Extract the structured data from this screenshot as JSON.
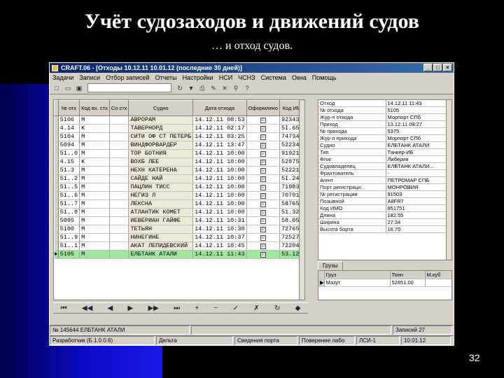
{
  "slide": {
    "title": "Учёт судозаходов и движений судов",
    "subtitle": "… и отход судов.",
    "page_number": "32"
  },
  "window": {
    "title": "CRAFT.06 - [Отходы 10.12.11 10.01.12 (последние 30 дней)]",
    "app_icon": "app-icon",
    "controls": [
      "_",
      "□",
      "×"
    ]
  },
  "menu": [
    "Задачи",
    "Записи",
    "Отбор записей",
    "Отчеты",
    "Настройки",
    "НСИ",
    "ЧСНЗ",
    "Система",
    "Окна",
    "Помощь"
  ],
  "toolbar": {
    "buttons": [
      "new-icon",
      "open-icon",
      "save-icon",
      "refresh-icon",
      "filter-icon",
      "print-icon",
      "edit-icon",
      "delete-icon",
      "find-icon",
      "help-icon"
    ]
  },
  "grid": {
    "headers": [
      "№ отх",
      "Код вх. стх",
      "Со стх",
      "Судно",
      "Дата отхода",
      "Оформлено",
      "Код ИМО",
      "Р"
    ],
    "rows": [
      [
        "5106",
        "М",
        "",
        "АВРОРАМ",
        "14.12.11 08:53",
        "☑",
        "9234389",
        "55"
      ],
      [
        "4.14",
        "К",
        "",
        "ТАВЕРНОРД",
        "14.12.11 02:17",
        "☑",
        "5I.6550",
        "60"
      ],
      [
        "5104",
        "М",
        "",
        "СИТИ ОФ СТ ПЕТЕРБ",
        "14.12.11 03:25",
        "☑",
        "7473456",
        "61"
      ],
      [
        "5094",
        "М",
        "",
        "ВИНДФОРВАРДЕР",
        "14.12.11 13:47",
        "☑",
        "5223452",
        "61"
      ],
      [
        "51..0",
        "М",
        "",
        "ТОР БОТНИЯ",
        "14.12.11 10:00",
        "☑",
        "9192129",
        "60"
      ],
      [
        "4.15",
        "К",
        "",
        "ВОХБ ЛЕЕ",
        "14.12.11 10:00",
        "☑",
        "5287507",
        "60"
      ],
      [
        "51.3",
        "М",
        "",
        "НЕХН КАТЕРЕНА",
        "14.12.11 10:00",
        "☑",
        "5222185",
        "60"
      ],
      [
        "51..2",
        "М",
        "",
        "САЙДЕ НАЙ",
        "14.12.11 10:00",
        "☑",
        "5I.2465",
        "55"
      ],
      [
        "51..5",
        "М",
        "",
        "ПАЦЛИН ТИСС",
        "14.12.11 10:00",
        "☑",
        "7198389",
        "60"
      ],
      [
        "51..6",
        "М",
        "",
        "НЕГИЗ Л",
        "14.12.11 10:00",
        "☑",
        "7070110",
        "55"
      ],
      [
        "51..7",
        "М",
        "",
        "ЛЕКСНА",
        "14.12.11 10:00",
        "☑",
        "5876572",
        "60"
      ],
      [
        "51..8",
        "М",
        "",
        "АТЛАНТИК КОМЕТ",
        "14.12.11 10:00",
        "☑",
        "51.3233",
        "60"
      ],
      [
        "5095",
        "М",
        "",
        "ИЕВЕРИАН ГАЙФЕ",
        "14.12.11 10:31",
        "☑",
        "58.0587",
        "60"
      ],
      [
        "5100",
        "М",
        "",
        "ТЕТЬЯН",
        "14.12.11 10:30",
        "☑",
        "727654",
        "60"
      ],
      [
        "51..9",
        "М",
        "",
        "НИНЕГИНЕ",
        "14.12.11 10:37",
        "☑",
        "7252754",
        "60"
      ],
      [
        "51..1",
        "М",
        "",
        "АКАТ ЛЕПИДЕВСКИЙ",
        "14.12.11 10:45",
        "☑",
        "7220435",
        "55"
      ],
      [
        "5105",
        "М",
        "",
        "ЕЛБТАНК АТАЛИ",
        "14.12.11 11:43",
        "☑",
        "53.125",
        "50"
      ]
    ],
    "selected_row": 16
  },
  "navigator": [
    "⏮",
    "◀◀",
    "◀",
    "▶",
    "▶▶",
    "⏭",
    "+",
    "−",
    "✓",
    "✗",
    "↻",
    "◆"
  ],
  "properties": [
    [
      "Отход",
      "14.12.11 11:43"
    ],
    [
      "№ отхода",
      "5105"
    ],
    [
      "Жур-л отхода",
      "Морпорт СПб"
    ],
    [
      "Приход",
      "13.12.11 09:27"
    ],
    [
      "№ прихода",
      "5375"
    ],
    [
      "Жур-л прихода",
      "Морпорт СПб"
    ],
    [
      "Судно",
      "ЕЛБТАНК АТАЛИ"
    ],
    [
      "Тип",
      "Танкер-ИБ"
    ],
    [
      "Флаг",
      "Либерия"
    ],
    [
      "Судовладелец",
      "ЕЛБТАНК АТАЛИ..."
    ],
    [
      "Фрахтователь",
      "-"
    ],
    [
      "Агент",
      "ПЕТРОМАР СПБ"
    ],
    [
      "Порт регистраци...",
      "МОНРОВИЯ"
    ],
    [
      "№ регистрации",
      "91503"
    ],
    [
      "Позывной",
      "A8FR7"
    ],
    [
      "Код ИМО",
      "951751"
    ],
    [
      "Длина",
      "182.55"
    ],
    [
      "Ширина",
      "27.34"
    ],
    [
      "Высота борта",
      "16.70"
    ]
  ],
  "tabs": [
    "Грузы"
  ],
  "cargo": {
    "headers": [
      "Груз",
      "Тонн",
      "М.куб"
    ],
    "rows": [
      [
        "Мазут",
        "52851.00",
        ""
      ]
    ]
  },
  "status1": [
    "№ 145644 ЕЛБТАНК АТАЛИ",
    "",
    "Записей 27"
  ],
  "status2": [
    "Разработчик (Б.1.0.0.6)",
    "Дельта",
    "Сведения порта",
    "Поверение лабо",
    "ЛСИ-1",
    "10.01.12"
  ]
}
